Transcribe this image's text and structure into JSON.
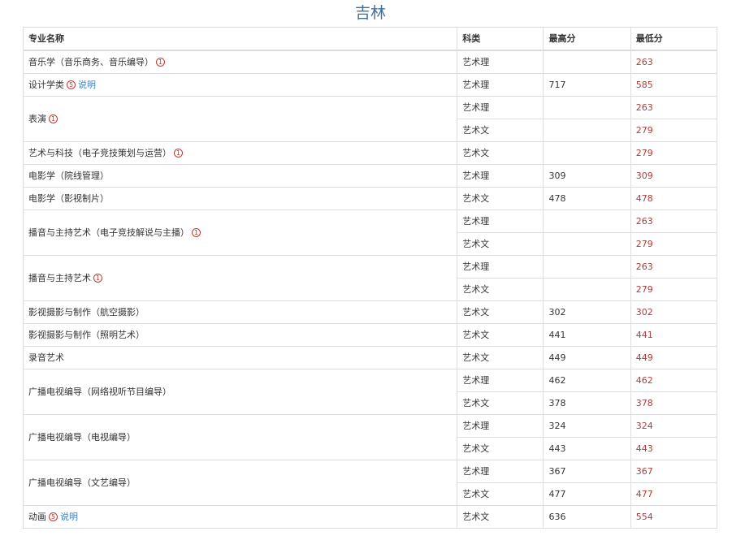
{
  "page_title": "吉林",
  "headers": {
    "major": "专业名称",
    "category": "科类",
    "max": "最高分",
    "min": "最低分"
  },
  "note_link_label": "说明",
  "rows": [
    {
      "major": "音乐学（音乐商务、音乐编导）",
      "note": "1",
      "link": false,
      "entries": [
        {
          "category": "艺术理",
          "max": "",
          "min": "263"
        }
      ]
    },
    {
      "major": "设计学类",
      "note": "5",
      "link": true,
      "entries": [
        {
          "category": "艺术理",
          "max": "717",
          "min": "585"
        }
      ]
    },
    {
      "major": "表演",
      "note": "1",
      "link": false,
      "entries": [
        {
          "category": "艺术理",
          "max": "",
          "min": "263"
        },
        {
          "category": "艺术文",
          "max": "",
          "min": "279"
        }
      ]
    },
    {
      "major": "艺术与科技（电子竞技策划与运营）",
      "note": "1",
      "link": false,
      "entries": [
        {
          "category": "艺术文",
          "max": "",
          "min": "279"
        }
      ]
    },
    {
      "major": "电影学（院线管理）",
      "note": "",
      "link": false,
      "entries": [
        {
          "category": "艺术理",
          "max": "309",
          "min": "309"
        }
      ]
    },
    {
      "major": "电影学（影视制片）",
      "note": "",
      "link": false,
      "entries": [
        {
          "category": "艺术文",
          "max": "478",
          "min": "478"
        }
      ]
    },
    {
      "major": "播音与主持艺术（电子竞技解说与主播）",
      "note": "1",
      "link": false,
      "entries": [
        {
          "category": "艺术理",
          "max": "",
          "min": "263"
        },
        {
          "category": "艺术文",
          "max": "",
          "min": "279"
        }
      ]
    },
    {
      "major": "播音与主持艺术",
      "note": "1",
      "link": false,
      "entries": [
        {
          "category": "艺术理",
          "max": "",
          "min": "263"
        },
        {
          "category": "艺术文",
          "max": "",
          "min": "279"
        }
      ]
    },
    {
      "major": "影视摄影与制作（航空摄影）",
      "note": "",
      "link": false,
      "entries": [
        {
          "category": "艺术文",
          "max": "302",
          "min": "302"
        }
      ]
    },
    {
      "major": "影视摄影与制作（照明艺术）",
      "note": "",
      "link": false,
      "entries": [
        {
          "category": "艺术文",
          "max": "441",
          "min": "441"
        }
      ]
    },
    {
      "major": "录音艺术",
      "note": "",
      "link": false,
      "entries": [
        {
          "category": "艺术文",
          "max": "449",
          "min": "449"
        }
      ]
    },
    {
      "major": "广播电视编导（网络视听节目编导）",
      "note": "",
      "link": false,
      "entries": [
        {
          "category": "艺术理",
          "max": "462",
          "min": "462"
        },
        {
          "category": "艺术文",
          "max": "378",
          "min": "378"
        }
      ]
    },
    {
      "major": "广播电视编导（电视编导）",
      "note": "",
      "link": false,
      "entries": [
        {
          "category": "艺术理",
          "max": "324",
          "min": "324"
        },
        {
          "category": "艺术文",
          "max": "443",
          "min": "443"
        }
      ]
    },
    {
      "major": "广播电视编导（文艺编导）",
      "note": "",
      "link": false,
      "entries": [
        {
          "category": "艺术理",
          "max": "367",
          "min": "367"
        },
        {
          "category": "艺术文",
          "max": "477",
          "min": "477"
        }
      ]
    },
    {
      "major": "动画",
      "note": "5",
      "link": true,
      "entries": [
        {
          "category": "艺术文",
          "max": "636",
          "min": "554"
        }
      ]
    }
  ]
}
